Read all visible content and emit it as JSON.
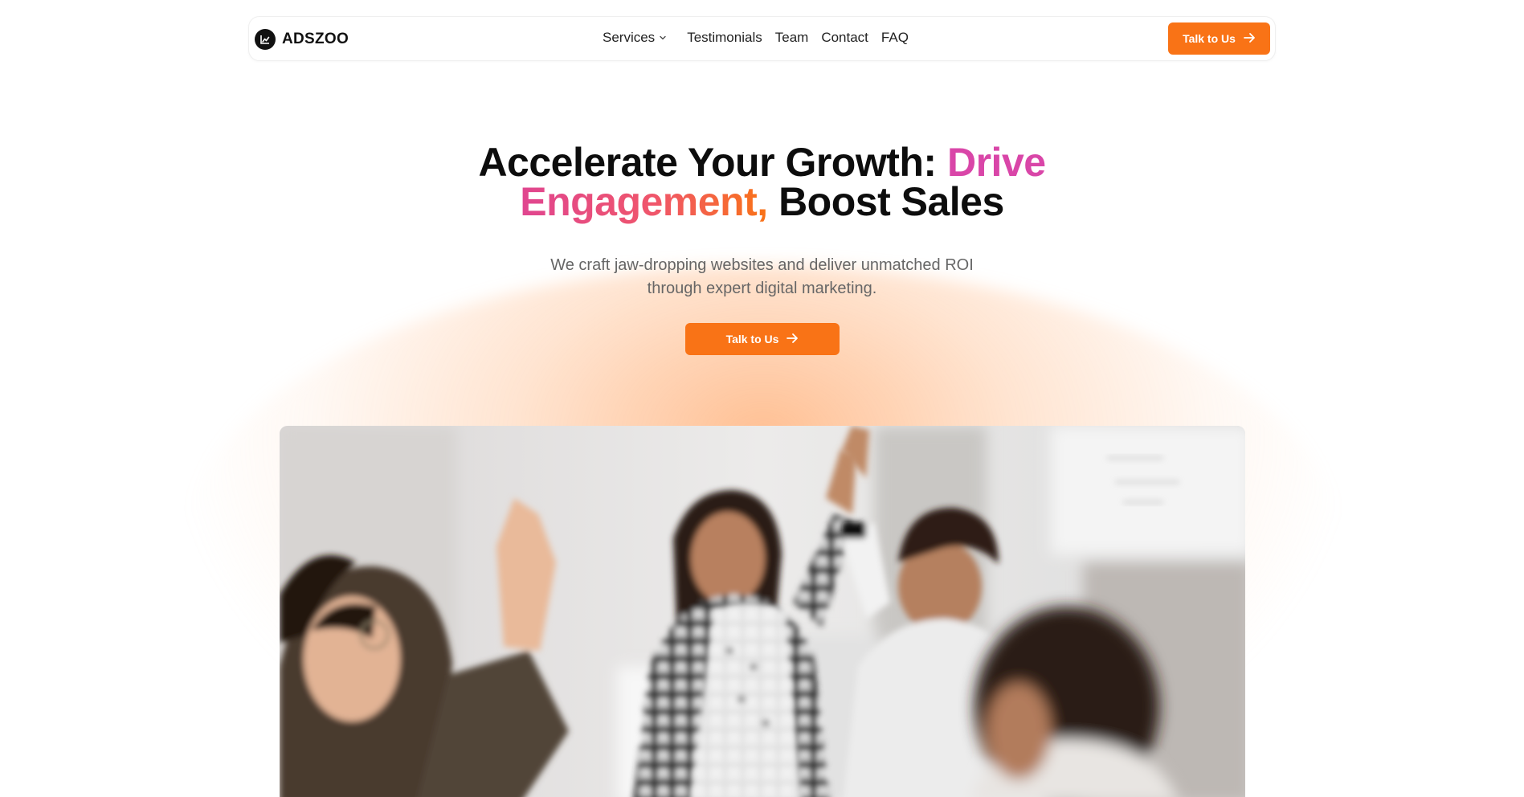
{
  "brand": {
    "name": "ADSZOO",
    "logo_icon": "bar-chart-icon"
  },
  "nav": {
    "items": [
      {
        "label": "Services",
        "icon": "chevron-down-icon"
      },
      {
        "label": "Testimonials"
      },
      {
        "label": "Team"
      },
      {
        "label": "Contact"
      },
      {
        "label": "FAQ"
      }
    ],
    "cta_label": "Talk to Us",
    "cta_icon": "arrow-right-icon"
  },
  "hero": {
    "title_part1": "Accelerate Your Growth: ",
    "title_highlight1": "Drive",
    "title_highlight2": "Engagement,",
    "title_part2": " Boost Sales",
    "subtitle_line1": "We craft jaw-dropping websites and deliver unmatched ROI",
    "subtitle_line2": "through expert digital marketing.",
    "cta_label": "Talk to Us",
    "cta_icon": "arrow-right-icon"
  },
  "colors": {
    "accent": "#f97316",
    "pink": "#d946a8",
    "text": "#0d0d0d",
    "muted": "#666666"
  }
}
